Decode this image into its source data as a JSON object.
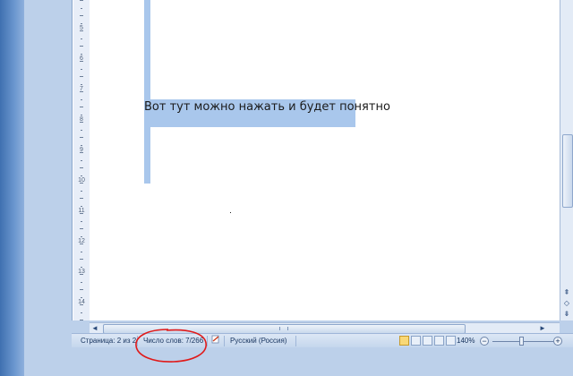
{
  "document": {
    "text_line": "Вот тут можно нажать и будет понятно"
  },
  "ruler": {
    "numbers": [
      "5",
      "6",
      "7",
      "8",
      "9",
      "10",
      "11",
      "12",
      "13",
      "14"
    ]
  },
  "status_bar": {
    "page": "Страница: 2 из 2",
    "words": "Число слов: 7/266",
    "language": "Русский (Россия)",
    "zoom": "140%"
  },
  "zoom_controls": {
    "minus": "−",
    "plus": "+"
  },
  "scroll_arrows": {
    "up": "▲",
    "down": "▼",
    "left": "◄",
    "right": "►",
    "prev_page": "⇞",
    "browse": "◇",
    "next_page": "⇟"
  },
  "colors": {
    "selection": "#a9c7ec",
    "annotation": "#e01a1a"
  }
}
